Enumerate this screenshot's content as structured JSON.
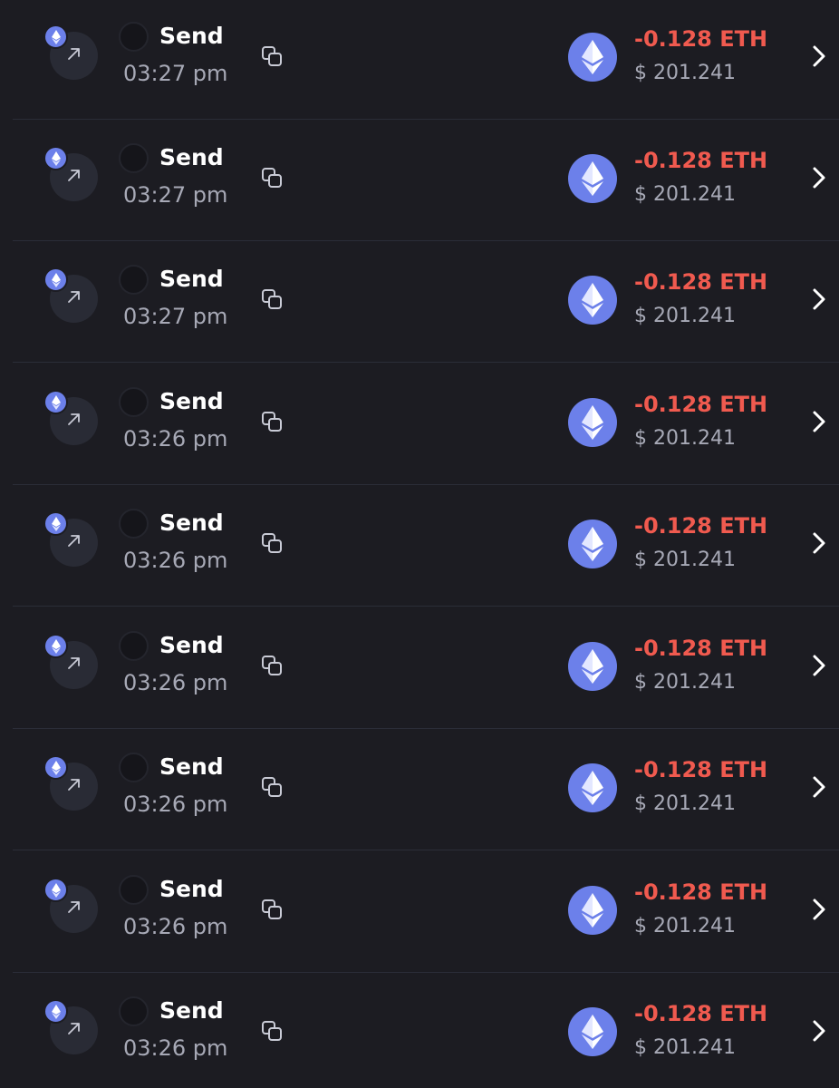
{
  "colors": {
    "background": "#1c1c22",
    "divider": "#2b2d38",
    "eth_blue": "#6c80ea",
    "amount_red": "#f05a4f",
    "secondary_text": "#a7a9b6"
  },
  "icons": {
    "coin": "ethereum-icon",
    "direction": "arrow-up-right-icon",
    "copy": "copy-icon",
    "open": "chevron-right-icon"
  },
  "transactions": [
    {
      "type": "Send",
      "time": "03:27 pm",
      "amount": "-0.128 ETH",
      "fiat": "$ 201.241"
    },
    {
      "type": "Send",
      "time": "03:27 pm",
      "amount": "-0.128 ETH",
      "fiat": "$ 201.241"
    },
    {
      "type": "Send",
      "time": "03:27 pm",
      "amount": "-0.128 ETH",
      "fiat": "$ 201.241"
    },
    {
      "type": "Send",
      "time": "03:26 pm",
      "amount": "-0.128 ETH",
      "fiat": "$ 201.241"
    },
    {
      "type": "Send",
      "time": "03:26 pm",
      "amount": "-0.128 ETH",
      "fiat": "$ 201.241"
    },
    {
      "type": "Send",
      "time": "03:26 pm",
      "amount": "-0.128 ETH",
      "fiat": "$ 201.241"
    },
    {
      "type": "Send",
      "time": "03:26 pm",
      "amount": "-0.128 ETH",
      "fiat": "$ 201.241"
    },
    {
      "type": "Send",
      "time": "03:26 pm",
      "amount": "-0.128 ETH",
      "fiat": "$ 201.241"
    },
    {
      "type": "Send",
      "time": "03:26 pm",
      "amount": "-0.128 ETH",
      "fiat": "$ 201.241"
    }
  ]
}
